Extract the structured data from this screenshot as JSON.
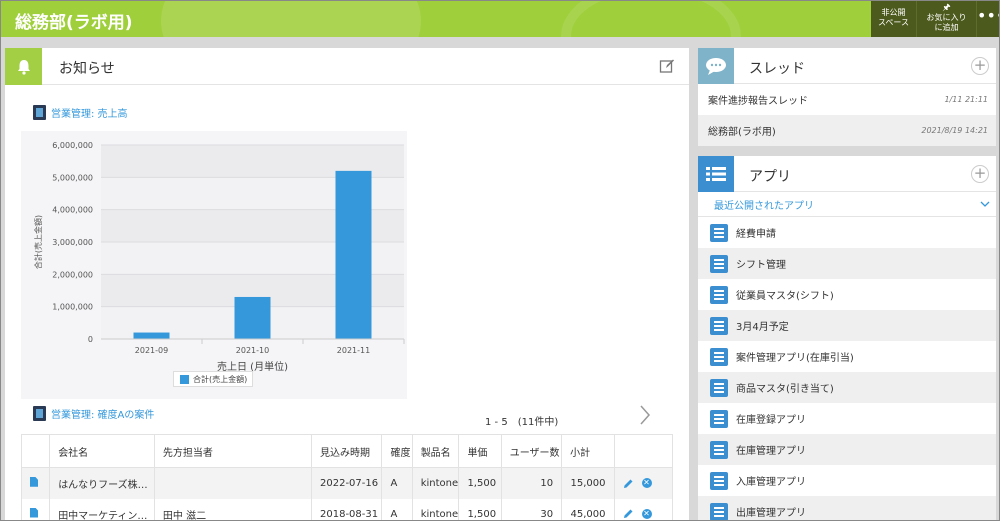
{
  "header": {
    "space_title": "総務部(ラボ用)",
    "private_line1": "非公開",
    "private_line2": "スペース",
    "favorite_line1": "お気に入り",
    "favorite_line2": "に追加",
    "more": "•••"
  },
  "notice": {
    "title": "お知らせ",
    "report1_title": "営業管理: 売上高",
    "report2_title": "営業管理: 確度Aの案件",
    "pager": "1 - 5　(11件中)"
  },
  "chart_data": {
    "type": "bar",
    "categories": [
      "2021-09",
      "2021-10",
      "2021-11"
    ],
    "series": [
      {
        "name": "合計(売上金額)",
        "values": [
          200000,
          1300000,
          5200000
        ]
      }
    ],
    "xlabel": "売上日 (月単位)",
    "ylabel": "合計(売上金額)",
    "ylim": [
      0,
      6000000
    ],
    "y_ticks": [
      "0",
      "1,000,000",
      "2,000,000",
      "3,000,000",
      "4,000,000",
      "5,000,000",
      "6,000,000"
    ],
    "grid": true,
    "legend_position": "bottom",
    "color": "#3498db"
  },
  "table": {
    "columns": [
      "会社名",
      "先方担当者",
      "見込み時期",
      "確度",
      "製品名",
      "単価",
      "ユーザー数",
      "小計"
    ],
    "rows": [
      [
        "はんなりフーズ株…",
        "",
        "2022-07-16",
        "A",
        "kintone",
        "1,500",
        "10",
        "15,000"
      ],
      [
        "田中マーケティン…",
        "田中 滋二",
        "2018-08-31",
        "A",
        "kintone",
        "1,500",
        "30",
        "45,000"
      ]
    ]
  },
  "thread": {
    "title": "スレッド",
    "plus": "+",
    "items": [
      {
        "name": "案件進捗報告スレッド",
        "date": "1/11 21:11"
      },
      {
        "name": "総務部(ラボ用)",
        "date": "2021/8/19 14:21"
      }
    ]
  },
  "apps": {
    "title": "アプリ",
    "plus": "+",
    "recent_label": "最近公開されたアプリ",
    "items": [
      "経費申請",
      "シフト管理",
      "従業員マスタ(シフト)",
      "3月4月予定",
      "案件管理アプリ(在庫引当)",
      "商品マスタ(引き当て)",
      "在庫登録アプリ",
      "在庫管理アプリ",
      "入庫管理アプリ",
      "出庫管理アプリ"
    ]
  }
}
